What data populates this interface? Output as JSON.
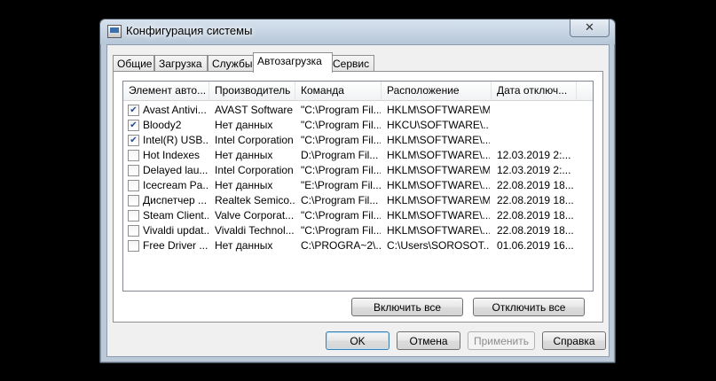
{
  "window": {
    "title": "Конфигурация системы",
    "close_glyph": "✕"
  },
  "tabs": [
    {
      "label": "Общие",
      "active": false
    },
    {
      "label": "Загрузка",
      "active": false
    },
    {
      "label": "Службы",
      "active": false
    },
    {
      "label": "Автозагрузка",
      "active": true
    },
    {
      "label": "Сервис",
      "active": false
    }
  ],
  "startup_list": {
    "columns": [
      "Элемент авто...",
      "Производитель",
      "Команда",
      "Расположение",
      "Дата отключ..."
    ],
    "rows": [
      {
        "checked": true,
        "item": "Avast Antivi...",
        "maker": "AVAST Software",
        "command": "\"C:\\Program Fil...",
        "location": "HKLM\\SOFTWARE\\M...",
        "date": ""
      },
      {
        "checked": true,
        "item": "Bloody2",
        "maker": "Нет данных",
        "command": "\"C:\\Program Fil...",
        "location": "HKCU\\SOFTWARE\\...",
        "date": ""
      },
      {
        "checked": true,
        "item": "Intel(R) USB...",
        "maker": "Intel Corporation",
        "command": "\"C:\\Program Fil...",
        "location": "HKLM\\SOFTWARE\\...",
        "date": ""
      },
      {
        "checked": false,
        "item": "Hot Indexes",
        "maker": "Нет данных",
        "command": "D:\\Program Fil...",
        "location": "HKLM\\SOFTWARE\\...",
        "date": "12.03.2019 2:..."
      },
      {
        "checked": false,
        "item": "Delayed lau...",
        "maker": "Intel Corporation",
        "command": "\"C:\\Program Fil...",
        "location": "HKLM\\SOFTWARE\\M...",
        "date": "12.03.2019 2:..."
      },
      {
        "checked": false,
        "item": "Icecream Pa...",
        "maker": "Нет данных",
        "command": "\"E:\\Program Fil...",
        "location": "HKLM\\SOFTWARE\\...",
        "date": "22.08.2019 18..."
      },
      {
        "checked": false,
        "item": "Диспетчер ...",
        "maker": "Realtek Semico...",
        "command": "C:\\Program Fil...",
        "location": "HKLM\\SOFTWARE\\M...",
        "date": "22.08.2019 18..."
      },
      {
        "checked": false,
        "item": "Steam Client...",
        "maker": "Valve Corporat...",
        "command": "\"C:\\Program Fil...",
        "location": "HKLM\\SOFTWARE\\...",
        "date": "22.08.2019 18..."
      },
      {
        "checked": false,
        "item": "Vivaldi updat...",
        "maker": "Vivaldi Technol...",
        "command": "\"C:\\Program Fil...",
        "location": "HKLM\\SOFTWARE\\...",
        "date": "22.08.2019 18..."
      },
      {
        "checked": false,
        "item": "Free Driver ...",
        "maker": "Нет данных",
        "command": "C:\\PROGRA~2\\...",
        "location": "C:\\Users\\SOROSOT...",
        "date": "01.06.2019 16..."
      }
    ]
  },
  "actions": {
    "enable_all": "Включить все",
    "disable_all": "Отключить все"
  },
  "footer": {
    "ok": "OK",
    "cancel": "Отмена",
    "apply": "Применить",
    "help": "Справка"
  }
}
